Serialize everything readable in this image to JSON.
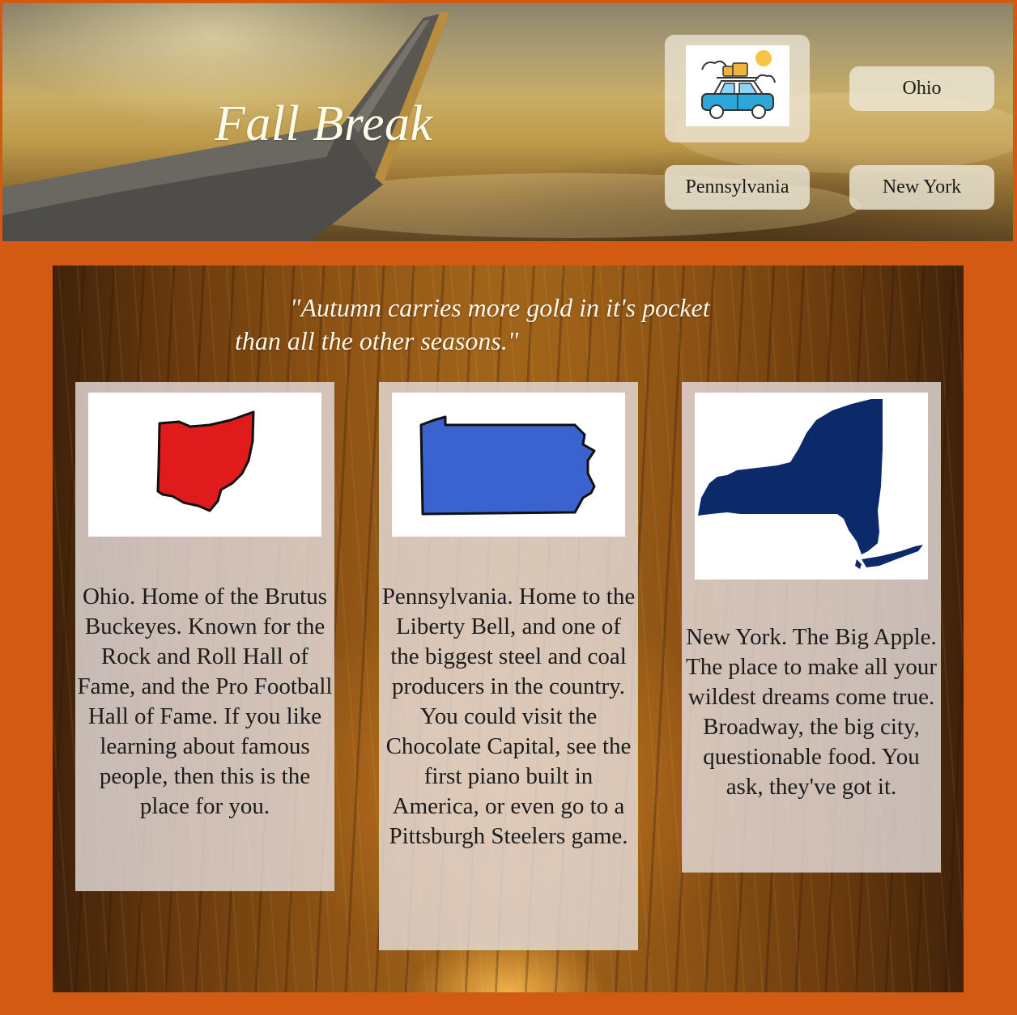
{
  "header": {
    "title": "Fall Break",
    "logo_icon": "car-with-luggage-icon",
    "nav": {
      "ohio": "Ohio",
      "pennsylvania": "Pennsylvania",
      "new_york": "New York"
    }
  },
  "quote": {
    "line1": "\"Autumn carries more gold in it's pocket",
    "line2": "than all the other seasons.\""
  },
  "cards": [
    {
      "state": "Ohio",
      "map_icon": "ohio-map-icon",
      "map_color": "#e01b1b",
      "text": "Ohio. Home of the Brutus Buckeyes. Known for the Rock and Roll Hall of Fame, and the Pro Football Hall of Fame. If you like learning about famous people, then this is the place for you."
    },
    {
      "state": "Pennsylvania",
      "map_icon": "pennsylvania-map-icon",
      "map_color": "#3a63d0",
      "text": "Pennsylvania. Home to the Liberty Bell, and one of the biggest steel and coal producers in the country. You could visit the Chocolate Capital, see the first piano built in America, or even go to a Pittsburgh Steelers game."
    },
    {
      "state": "New York",
      "map_icon": "new-york-map-icon",
      "map_color": "#0c2a6a",
      "text": "New York. The Big Apple. The place to make all your wildest dreams come true. Broadway, the big city, questionable food. You ask, they've got it."
    }
  ],
  "colors": {
    "page_background": "#d35a12",
    "card_background": "#e4dcda",
    "nav_button": "#ece6d6"
  }
}
